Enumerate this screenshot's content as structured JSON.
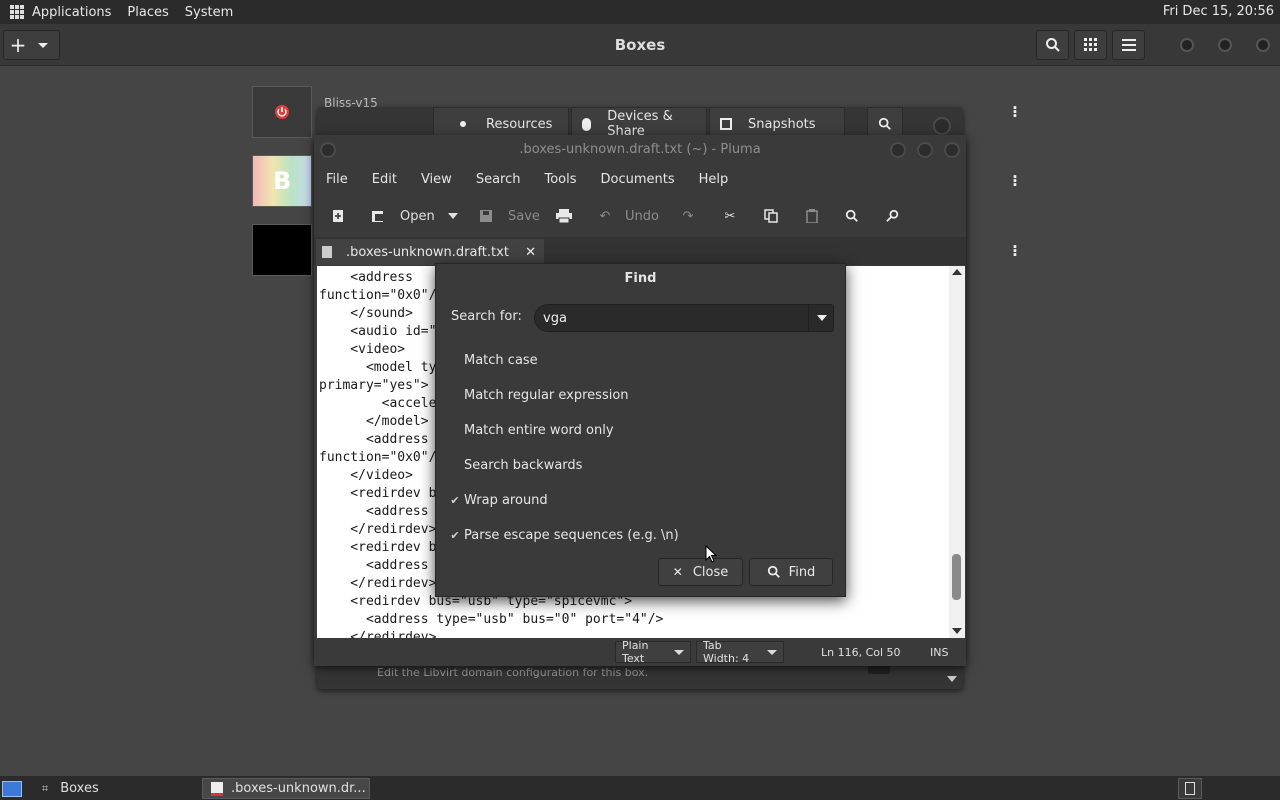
{
  "top_panel": {
    "menus": [
      "Applications",
      "Places",
      "System"
    ],
    "clock": "Fri Dec 15, 20:56"
  },
  "boxes": {
    "title": "Boxes",
    "box_label": "Bliss-v15",
    "tabs": [
      "Resources",
      "Devices & Share",
      "Snapshots"
    ],
    "footer_hint": "Edit the Libvirt domain configuration for this box."
  },
  "pluma": {
    "title": ".boxes-unknown.draft.txt (~) - Pluma",
    "menu": [
      "File",
      "Edit",
      "View",
      "Search",
      "Tools",
      "Documents",
      "Help"
    ],
    "toolbar": {
      "open": "Open",
      "save": "Save",
      "undo": "Undo"
    },
    "tab_label": ".boxes-unknown.draft.txt",
    "editor_text": "    <address\nfunction=\"0x0\"/\n    </sound>\n    <audio id=\"\n    <video>\n      <model ty                                             ads=\"1\"\nprimary=\"yes\">\n        <accele\n      </model>\n      <address\nfunction=\"0x0\"/\n    </video>\n    <redirdev b\n      <address\n    </redirdev>\n    <redirdev b\n      <address\n    </redirdev>\n    <redirdev bus=\"usb\" type=\"spicevmc\">\n      <address type=\"usb\" bus=\"0\" port=\"4\"/>\n    </redirdev>",
    "status": {
      "language": "Plain Text",
      "tab_width": "Tab Width:  4",
      "position": "Ln 116, Col 50",
      "mode": "INS"
    }
  },
  "find_dialog": {
    "title": "Find",
    "search_label": "Search for:",
    "search_value": "vga",
    "options": [
      {
        "label": "Match case",
        "checked": false
      },
      {
        "label": "Match regular expression",
        "checked": false
      },
      {
        "label": "Match entire word only",
        "checked": false
      },
      {
        "label": "Search backwards",
        "checked": false
      },
      {
        "label": "Wrap around",
        "checked": true
      },
      {
        "label": "Parse escape sequences (e.g. \\n)",
        "checked": true
      }
    ],
    "close_label": "Close",
    "find_label": "Find"
  },
  "taskbar": {
    "items": [
      "Boxes",
      ".boxes-unknown.dr..."
    ]
  },
  "colors": {
    "panel": "#2b2b2b",
    "desktop": "#454545",
    "power_red": "#e03c3c"
  }
}
